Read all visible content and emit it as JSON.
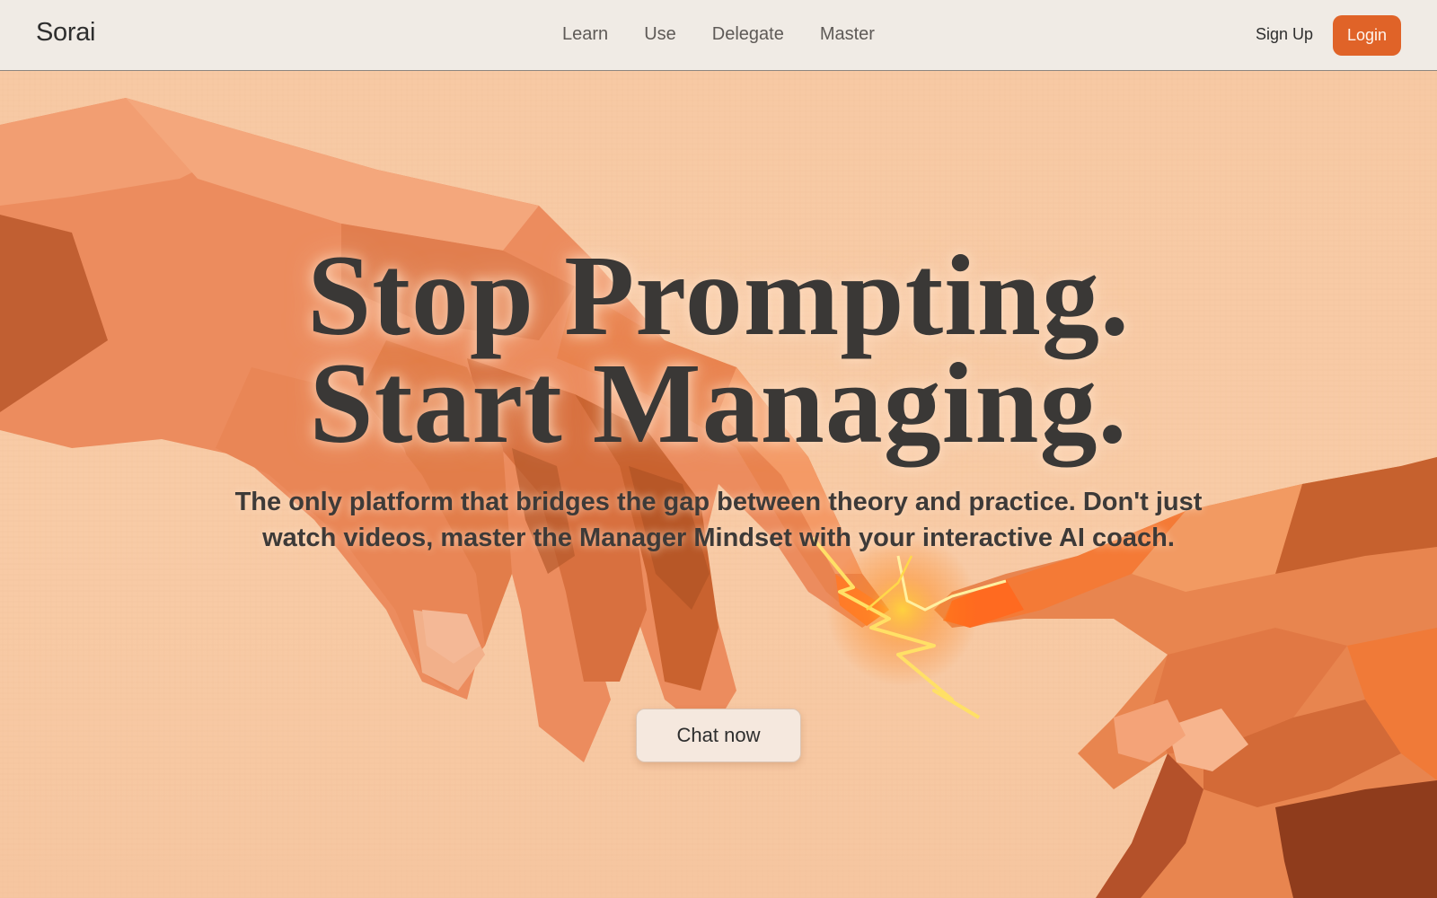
{
  "nav": {
    "brand": "Sorai",
    "links": [
      {
        "label": "Learn"
      },
      {
        "label": "Use"
      },
      {
        "label": "Delegate"
      },
      {
        "label": "Master"
      }
    ],
    "sign_up": "Sign Up",
    "login": "Login"
  },
  "hero": {
    "headline_line1": "Stop Prompting.",
    "headline_line2": "Start Managing.",
    "subtitle": "The only platform that bridges the gap between theory and practice. Don't just watch videos, master the Manager Mindset with your interactive AI coach.",
    "cta": "Chat now"
  },
  "colors": {
    "accent": "#e06328",
    "nav_background": "#f0ebe5",
    "hero_background": "#f7c9a4",
    "text_dark": "#3a3836"
  }
}
